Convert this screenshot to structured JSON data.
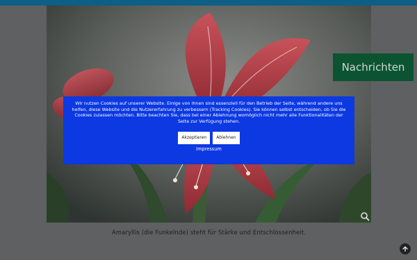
{
  "caption": "Amaryllis (die Funkelnde) steht für Stärke und Entschlossenheit.",
  "side_tab": {
    "label": "Nachrichten"
  },
  "cookie_banner": {
    "message": "Wir nutzen Cookies auf unserer Website. Einige von ihnen sind essenziell für den Betrieb der Seite, während andere uns helfen, diese Website und die Nutzererfahrung zu verbessern (Tracking Cookies). Sie können selbst entscheiden, ob Sie die Cookies zulassen möchten. Bitte beachten Sie, dass bei einer Ablehnung womöglich nicht mehr alle Funktionalitäten der Seite zur Verfügung stehen.",
    "accept_label": "Akzeptieren",
    "decline_label": "Ablehnen",
    "impressum_label": "Impressum"
  },
  "colors": {
    "topbar": "#0d5f86",
    "banner": "#0c39e1",
    "side_tab": "#0c5431",
    "page_background": "#5f6062"
  },
  "icons": [
    "magnifier-icon",
    "arrow-up-icon"
  ]
}
